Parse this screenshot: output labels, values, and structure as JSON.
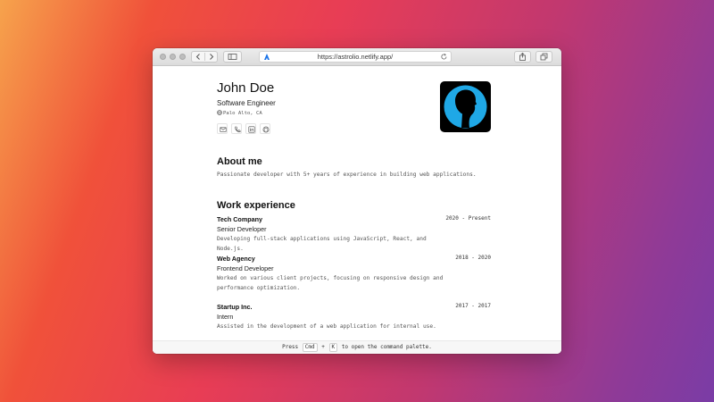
{
  "browser": {
    "url": "https://astrolio.netlify.app/",
    "icons": [
      "back-arrow-icon",
      "forward-arrow-icon",
      "sidebar-icon",
      "site-favicon-icon",
      "reload-icon",
      "share-icon",
      "tabs-icon"
    ]
  },
  "profile": {
    "name": "John Doe",
    "role": "Software Engineer",
    "location": "Palo Alto, CA",
    "contacts": [
      "mail-icon",
      "phone-icon",
      "linkedin-icon",
      "github-icon"
    ]
  },
  "about": {
    "heading": "About me",
    "text": "Passionate developer with 5+ years of experience in building web applications."
  },
  "work": {
    "heading": "Work experience",
    "jobs": [
      {
        "company": "Tech Company",
        "title": "Senior Developer",
        "dates": "2020 - Present",
        "desc": "Developing full-stack applications using JavaScript, React, and Node.js."
      },
      {
        "company": "Web Agency",
        "title": "Frontend Developer",
        "dates": "2018 - 2020",
        "desc": "Worked on various client projects, focusing on responsive design and performance optimization."
      },
      {
        "company": "Startup Inc.",
        "title": "Intern",
        "dates": "2017 - 2017",
        "desc": "Assisted in the development of a web application for internal use."
      }
    ]
  },
  "footer": {
    "before": "Press",
    "key1": "Cmd",
    "plus": "+",
    "key2": "K",
    "after": "to open the command palette."
  },
  "colors": {
    "avatar_blue": "#1fa8e6",
    "avatar_bg": "#000000"
  }
}
